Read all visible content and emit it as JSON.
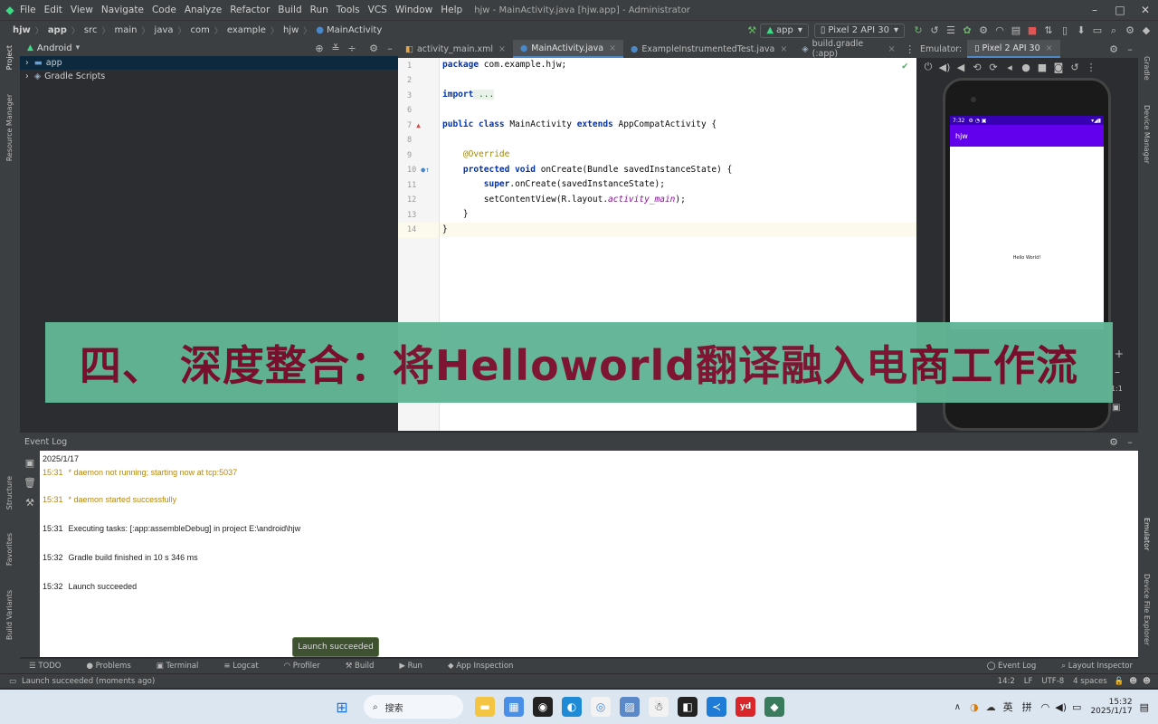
{
  "app": {
    "menu": [
      "File",
      "Edit",
      "View",
      "Navigate",
      "Code",
      "Analyze",
      "Refactor",
      "Build",
      "Run",
      "Tools",
      "VCS",
      "Window",
      "Help"
    ],
    "window_title": "hjw - MainActivity.java [hjw.app] - Administrator"
  },
  "breadcrumb": [
    "hjw",
    "app",
    "src",
    "main",
    "java",
    "com",
    "example",
    "hjw",
    "MainActivity"
  ],
  "toolbar": {
    "run_config": "app",
    "device": "Pixel 2 API 30"
  },
  "project": {
    "view": "Android",
    "items": [
      "app",
      "Gradle Scripts"
    ]
  },
  "left_tools": [
    "Project",
    "Resource Manager",
    "Structure",
    "Favorites",
    "Build Variants"
  ],
  "right_tools": [
    "Gradle",
    "Device Manager",
    "Emulator",
    "Device File Explorer"
  ],
  "editor": {
    "tabs": [
      "activity_main.xml",
      "MainActivity.java",
      "ExampleInstrumentedTest.java",
      "build.gradle (:app)"
    ],
    "active_tab": "MainActivity.java",
    "line_numbers": [
      "1",
      "2",
      "3",
      "6",
      "7",
      "8",
      "9",
      "10",
      "11",
      "12",
      "13",
      "14"
    ],
    "code": {
      "l1_kw": "package",
      "l1_rest": " com.example.hjw;",
      "l3_kw": "import",
      "l3_fold": " ...",
      "l7_kw1": "public class",
      "l7_mid": " MainActivity ",
      "l7_kw2": "extends",
      "l7_rest": " AppCompatActivity {",
      "l9_ann": "@Override",
      "l10_kw": "protected void",
      "l10_rest": " onCreate(Bundle savedInstanceState) {",
      "l11_kw": "super",
      "l11_rest": ".onCreate(savedInstanceState);",
      "l12_pre": "setContentView(R.layout.",
      "l12_it": "activity_main",
      "l12_post": ");",
      "l13": "}",
      "l14": "}"
    }
  },
  "emulator": {
    "label": "Emulator:",
    "tab": "Pixel 2 API 30",
    "app_title": "hjw",
    "status_time": "7:32",
    "screen_text": "Hello World!",
    "zoom": "1:1"
  },
  "banner": {
    "text": "四、 深度整合：将Helloworld翻译融入电商工作流"
  },
  "event_log": {
    "title": "Event Log",
    "date": "2025/1/17",
    "entries": [
      {
        "time": "15:31",
        "msg": "* daemon not running; starting now at tcp:5037",
        "warn": true
      },
      {
        "time": "15:31",
        "msg": "* daemon started successfully",
        "warn": true
      },
      {
        "time": "15:31",
        "msg": "Executing tasks: [:app:assembleDebug] in project E:\\android\\hjw",
        "warn": false
      },
      {
        "time": "15:32",
        "msg": "Gradle build finished in 10 s 346 ms",
        "warn": false
      },
      {
        "time": "15:32",
        "msg": "Launch succeeded",
        "warn": false
      }
    ]
  },
  "toast": "Launch succeeded",
  "bottom_tools": [
    "TODO",
    "Problems",
    "Terminal",
    "Logcat",
    "Profiler",
    "Build",
    "Run",
    "App Inspection"
  ],
  "bottom_right_tools": [
    "Event Log",
    "Layout Inspector"
  ],
  "status": {
    "message": "Launch succeeded (moments ago)",
    "position": "14:2",
    "line_sep": "LF",
    "encoding": "UTF-8",
    "indent": "4 spaces"
  },
  "taskbar": {
    "search": "搜索",
    "ime1": "英",
    "ime2": "拼",
    "time": "15:32",
    "date": "2025/1/17",
    "yd": "yd"
  },
  "colors": {
    "accent": "#4a88c7",
    "banner_bg": "#62b596",
    "banner_text": "#7a0f2d",
    "emu_appbar": "#6200ee"
  }
}
